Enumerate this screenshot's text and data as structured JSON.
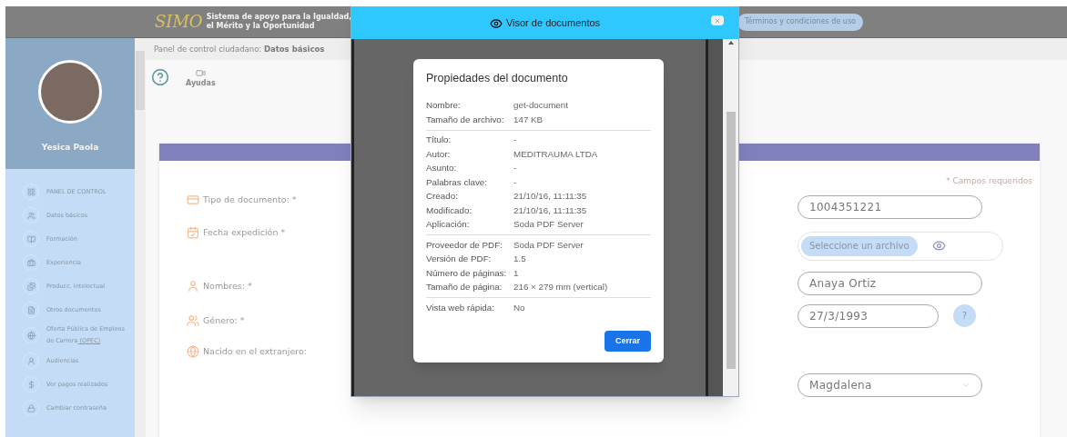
{
  "header": {
    "logo_mark": "SIMO",
    "logo_lines": [
      "Sistema de apoyo para la Igualdad,",
      "el Mérito y la Oportunidad"
    ],
    "terms_button": "Términos y condiciones de uso"
  },
  "sidebar": {
    "user_name": "Yesica Paola",
    "items": [
      {
        "label": "PANEL DE CONTROL"
      },
      {
        "label": "Datos básicos"
      },
      {
        "label": "Formación"
      },
      {
        "label": "Experiencia"
      },
      {
        "label": "Producc. intelectual"
      },
      {
        "label": "Otros documentos"
      },
      {
        "label": "Oferta Pública de Empleos de Carrera",
        "link": "(OPEC)"
      },
      {
        "label": "Audiencias"
      },
      {
        "label": "Ver pagos realizados"
      },
      {
        "label": "Cambiar contraseña"
      }
    ]
  },
  "breadcrumb": {
    "prefix": "Panel de control ciudadano:",
    "current": "Datos básicos"
  },
  "toolbar": {
    "help_video": "Ayudas"
  },
  "form": {
    "required_note": "* Campos requeridos",
    "labels": [
      "Tipo de documento: *",
      "Fecha expedición *",
      "Nombres: *",
      "Género: *",
      "Nacido en el extranjero:"
    ],
    "fields": [
      {
        "kind": "text",
        "value": "1004351221"
      },
      {
        "kind": "file",
        "button": "Seleccione un archivo"
      },
      {
        "kind": "text",
        "value": "Anaya Ortiz"
      },
      {
        "kind": "date",
        "value": "27/3/1993",
        "help": "?"
      },
      {
        "kind": "select",
        "value": "Magdalena"
      }
    ]
  },
  "viewer": {
    "title": "Visor de documentos",
    "properties": {
      "title": "Propiedades del documento",
      "groups": [
        [
          {
            "label": "Nombre:",
            "value": "get-document"
          },
          {
            "label": "Tamaño de archivo:",
            "value": "147 KB"
          }
        ],
        [
          {
            "label": "Título:",
            "value": "-"
          },
          {
            "label": "Autor:",
            "value": "MEDITRAUMA LTDA"
          },
          {
            "label": "Asunto:",
            "value": "-"
          },
          {
            "label": "Palabras clave:",
            "value": "-"
          },
          {
            "label": "Creado:",
            "value": "21/10/16, 11:11:35"
          },
          {
            "label": "Modificado:",
            "value": "21/10/16, 11:11:35"
          },
          {
            "label": "Aplicación:",
            "value": "Soda PDF Server"
          }
        ],
        [
          {
            "label": "Proveedor de PDF:",
            "value": "Soda PDF Server"
          },
          {
            "label": "Versión de PDF:",
            "value": "1.5"
          },
          {
            "label": "Número de páginas:",
            "value": "1"
          },
          {
            "label": "Tamaño de página:",
            "value": "216 × 279 mm (vertical)"
          }
        ],
        [
          {
            "label": "Vista web rápida:",
            "value": "No"
          }
        ]
      ],
      "close_button": "Cerrar"
    }
  }
}
